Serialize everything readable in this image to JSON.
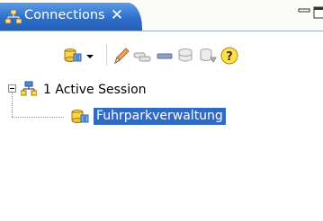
{
  "tab": {
    "label": "Connections",
    "icon": "connections-icon",
    "close_symbol": "✕"
  },
  "window_controls": [
    "minimize-icon",
    "maximize-icon"
  ],
  "toolbar": {
    "items": [
      "new-connection-icon",
      "chevron-down-icon",
      "edit-pencil-icon",
      "connect-icon",
      "disconnect-icon",
      "database-icon",
      "database-export-icon",
      "help-icon"
    ]
  },
  "tree": {
    "root": {
      "label": "1 Active Session",
      "icon": "session-network-icon",
      "expanded": true
    },
    "child": {
      "label": "Fuhrparkverwaltung",
      "icon": "connection-icon",
      "selected": true
    }
  },
  "colors": {
    "tab_active": "#2f6fc9",
    "selection": "#316ac5",
    "toolbar_border": "#9db4d8"
  }
}
